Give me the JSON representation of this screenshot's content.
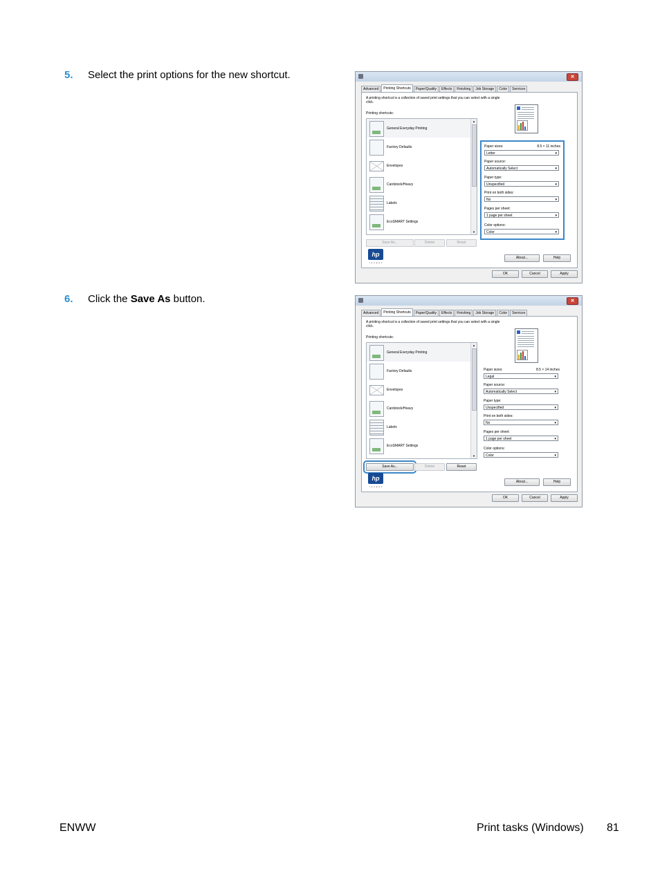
{
  "steps": [
    {
      "number": "5.",
      "text": "Select the print options for the new shortcut."
    },
    {
      "number": "6.",
      "text_before": "Click the ",
      "text_bold": "Save As",
      "text_after": " button."
    }
  ],
  "dialog": {
    "close_glyph": "✕",
    "tabs": [
      "Advanced",
      "Printing Shortcuts",
      "Paper/Quality",
      "Effects",
      "Finishing",
      "Job Storage",
      "Color",
      "Services"
    ],
    "description": "A printing shortcut is a collection of saved print settings that you can select with a single click.",
    "shortcuts_label": "Printing shortcuts:",
    "shortcuts": [
      "General Everyday Printing",
      "Factory Defaults",
      "Envelopes",
      "Cardstock/Heavy",
      "Labels",
      "EcoSMART Settings"
    ],
    "scroll_up": "▲",
    "scroll_down": "▼",
    "labels": {
      "paper_sizes": "Paper sizes:",
      "paper_source": "Paper source:",
      "paper_type": "Paper type:",
      "both_sides": "Print on both sides:",
      "pages_per_sheet": "Pages per sheet:",
      "color_options": "Color options:"
    },
    "buttons": {
      "save_as": "Save As...",
      "delete": "Delete",
      "reset": "Reset",
      "about": "About...",
      "help": "Help",
      "ok": "OK",
      "cancel": "Cancel",
      "apply": "Apply"
    },
    "logo_text": "hp",
    "invent_text": "invent"
  },
  "shot1": {
    "size_display": "8.5 × 11 inches",
    "paper_size": "Letter",
    "paper_source": "Automatically Select",
    "paper_type": "Unspecified",
    "both_sides": "No",
    "pages_per_sheet": "1 page per sheet",
    "color_option": "Color"
  },
  "shot2": {
    "size_display": "8.5 × 14 inches",
    "paper_size": "Legal",
    "paper_source": "Automatically Select",
    "paper_type": "Unspecified",
    "both_sides": "No",
    "pages_per_sheet": "1 page per sheet",
    "color_option": "Color"
  },
  "footer": {
    "left": "ENWW",
    "center": "Print tasks (Windows)",
    "page": "81"
  },
  "colors": {
    "step_number": "#2a8fd0",
    "highlight": "#3a86c8",
    "hp_blue": "#174a93"
  }
}
